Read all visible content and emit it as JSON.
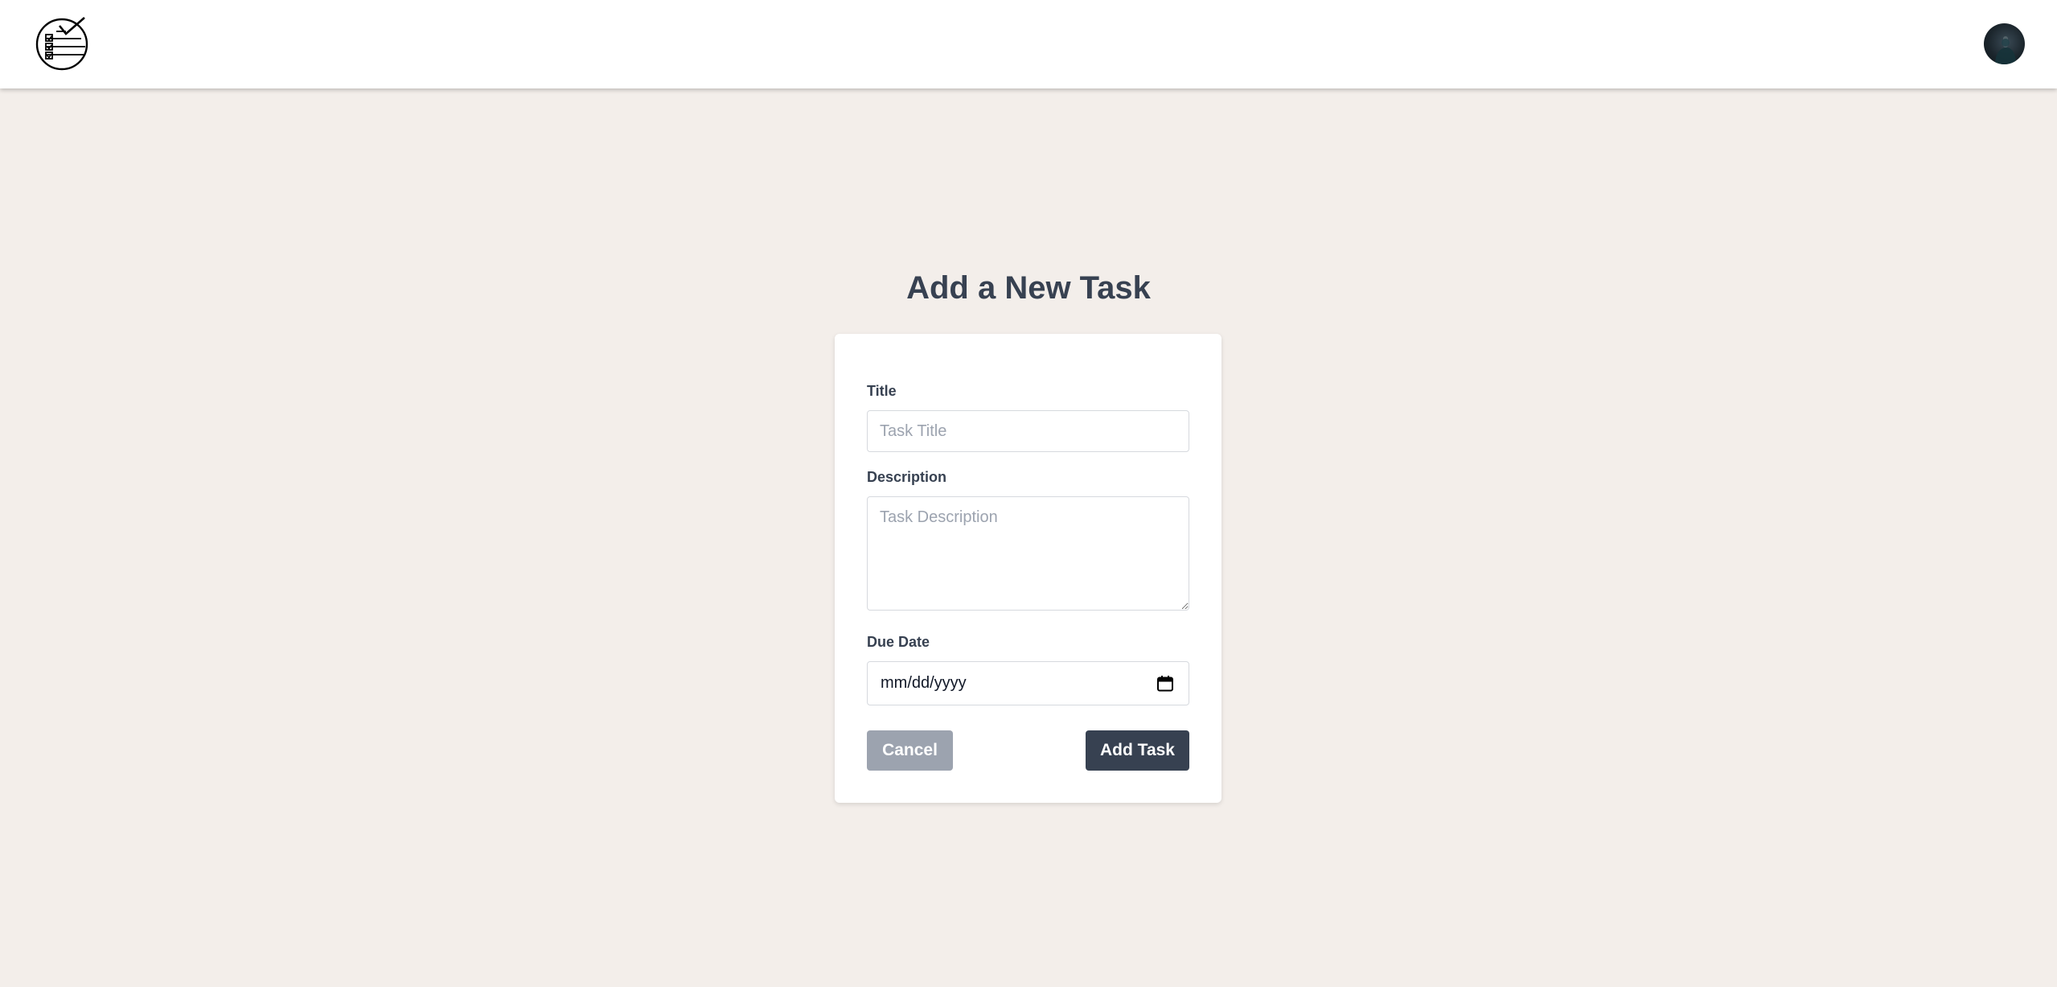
{
  "header": {
    "logo_icon": "checklist-globe-icon",
    "avatar_icon": "user-avatar"
  },
  "page": {
    "title": "Add a New Task"
  },
  "form": {
    "title_label": "Title",
    "title_placeholder": "Task Title",
    "title_value": "",
    "description_label": "Description",
    "description_placeholder": "Task Description",
    "description_value": "",
    "due_date_label": "Due Date",
    "due_date_value": "mm/dd/yyyy",
    "cancel_label": "Cancel",
    "submit_label": "Add Task"
  },
  "colors": {
    "background": "#f3eeea",
    "header": "#ffffff",
    "primary_button": "#374151",
    "secondary_button": "#9ca3af",
    "text": "#374151"
  }
}
